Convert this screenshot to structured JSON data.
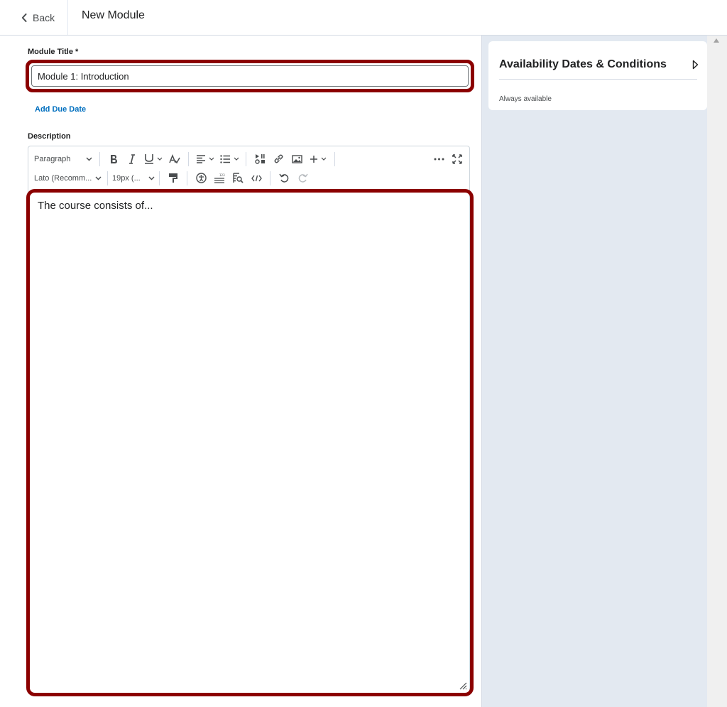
{
  "header": {
    "back_label": "Back",
    "page_title": "New Module"
  },
  "form": {
    "module_title_label": "Module Title *",
    "module_title_value": "Module 1: Introduction",
    "add_due_date": "Add Due Date",
    "description_label": "Description"
  },
  "editor": {
    "block_format": "Paragraph",
    "font_family": "Lato (Recomm...",
    "font_size": "19px (...",
    "content": "The course consists of..."
  },
  "sidebar": {
    "availability_title": "Availability Dates & Conditions",
    "availability_status": "Always available"
  },
  "icons": [
    "chevron-left-icon",
    "chevron-down-icon",
    "bold-icon",
    "italic-icon",
    "underline-icon",
    "clear-format-icon",
    "align-left-icon",
    "list-icon",
    "media-icon",
    "link-icon",
    "image-icon",
    "plus-icon",
    "more-icon",
    "fullscreen-icon",
    "format-painter-icon",
    "accessibility-icon",
    "word-count-icon",
    "find-replace-icon",
    "code-icon",
    "undo-icon",
    "redo-icon",
    "resize-icon",
    "chevron-right-icon",
    "scroll-up-icon"
  ]
}
